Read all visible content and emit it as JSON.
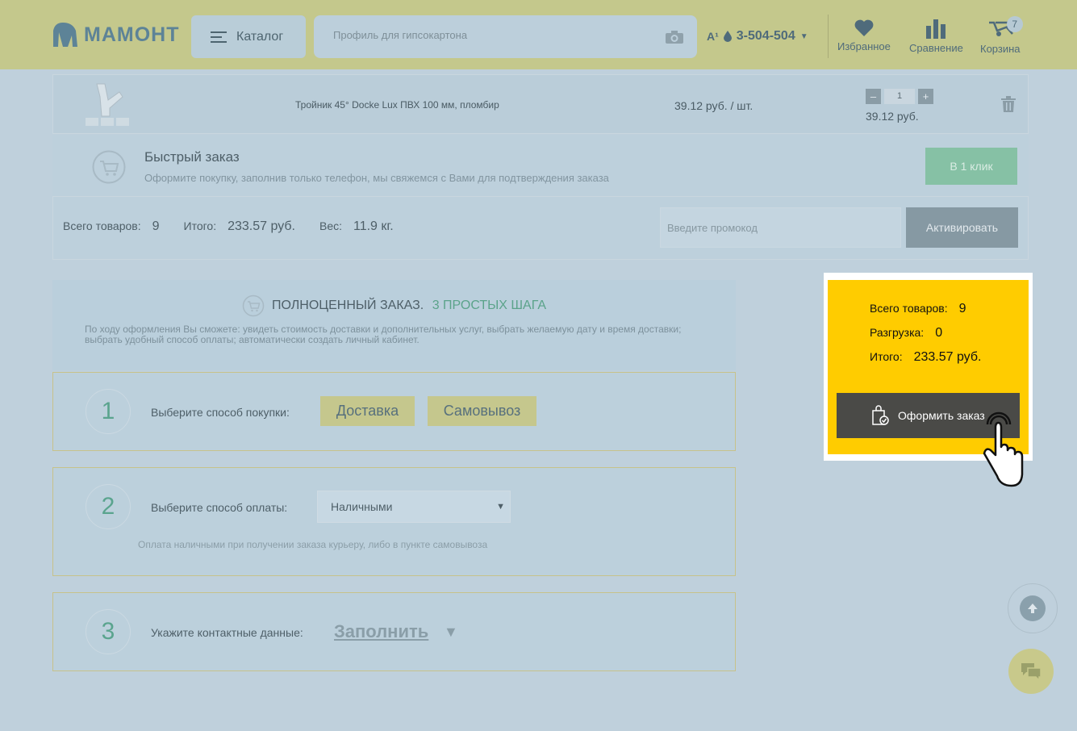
{
  "header": {
    "logo_text": "МАМОНТ",
    "catalog_label": "Каталог",
    "search_placeholder": "Профиль для гипсокартона",
    "phone": "3-504-504",
    "favorites_label": "Избранное",
    "compare_label": "Сравнение",
    "cart_label": "Корзина",
    "cart_count": "7"
  },
  "product": {
    "name": "Тройник 45° Docke Lux ПВХ 100 мм, пломбир",
    "unit_price": "39.12 руб. / шт.",
    "quantity": "1",
    "sum": "39.12 руб.",
    "minus": "–",
    "plus": "+"
  },
  "quick_order": {
    "title": "Быстрый заказ",
    "subtitle": "Оформите покупку, заполнив только телефон, мы свяжемся с Вами для подтверждения заказа",
    "button": "В 1 клик"
  },
  "totals": {
    "items_label": "Всего товаров:",
    "items_value": "9",
    "total_label": "Итого:",
    "total_value": "233.57 руб.",
    "weight_label": "Вес:",
    "weight_value": "11.9 кг.",
    "promo_placeholder": "Введите промокод",
    "activate": "Активировать"
  },
  "full_order": {
    "title": "ПОЛНОЦЕННЫЙ ЗАКАЗ.",
    "accent": "3 ПРОСТЫХ ШАГА",
    "desc": "По ходу оформления Вы сможете: увидеть стоимость доставки и дополнительных услуг, выбрать желаемую дату и время доставки; выбрать удобный способ оплаты; автоматически создать личный кабинет."
  },
  "steps": {
    "s1": {
      "num": "1",
      "label": "Выберите способ покупки:",
      "opt1": "Доставка",
      "opt2": "Самовывоз"
    },
    "s2": {
      "num": "2",
      "label": "Выберите способ оплаты:",
      "selected": "Наличными",
      "note": "Оплата наличными при получении заказа курьеру, либо в пункте самовывоза"
    },
    "s3": {
      "num": "3",
      "label": "Укажите контактные данные:",
      "link": "Заполнить",
      "arrow": "▼"
    }
  },
  "summary": {
    "items_label": "Всего товаров:",
    "items_value": "9",
    "unload_label": "Разгрузка:",
    "unload_value": "0",
    "total_label": "Итого:",
    "total_value": "233.57 руб.",
    "checkout": "Оформить заказ"
  },
  "colors": {
    "header_bg": "#c4c88c",
    "highlight": "#ffcc00",
    "accent_green": "#5ba38a",
    "checkout_bg": "#4a4a47"
  }
}
